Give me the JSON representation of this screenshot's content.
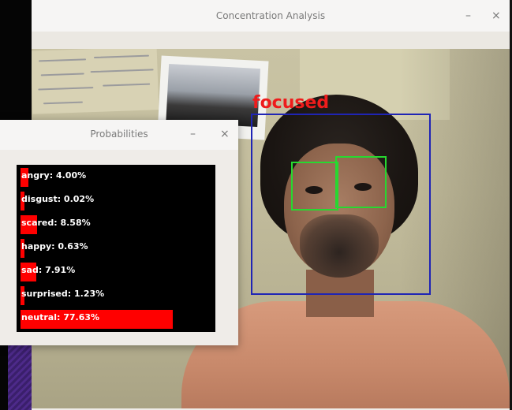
{
  "main_window": {
    "title": "Concentration Analysis",
    "minimize": "–",
    "close": "×"
  },
  "detection": {
    "state_label": "focused",
    "face_box_color": "#1f24b5",
    "eye_box_color": "#27d830",
    "label_color": "#ee1c1c"
  },
  "probabilities_window": {
    "title": "Probabilities",
    "minimize": "–",
    "close": "×",
    "bar_color": "#ff0000",
    "emotions": [
      {
        "label": "angry: 4.00%",
        "value": 4.0
      },
      {
        "label": "disgust: 0.02%",
        "value": 0.02
      },
      {
        "label": "scared: 8.58%",
        "value": 8.58
      },
      {
        "label": "happy: 0.63%",
        "value": 0.63
      },
      {
        "label": "sad: 7.91%",
        "value": 7.91
      },
      {
        "label": "surprised: 1.23%",
        "value": 1.23
      },
      {
        "label": "neutral: 77.63%",
        "value": 77.63
      }
    ]
  }
}
